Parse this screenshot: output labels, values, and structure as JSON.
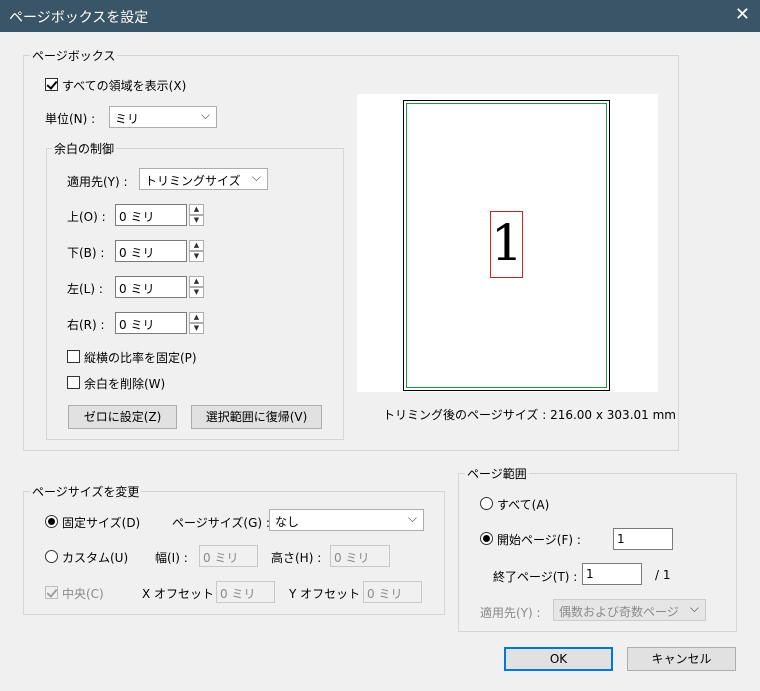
{
  "window": {
    "title": "ページボックスを設定",
    "close_glyph": "✕"
  },
  "pagebox": {
    "legend": "ページボックス",
    "show_all_label": "すべての領域を表示(X)",
    "show_all_checked": true,
    "unit_label": "単位(N) :",
    "unit_value": "ミリ",
    "margin_group": {
      "legend": "余白の制御",
      "apply_label": "適用先(Y) :",
      "apply_value": "トリミングサイズ",
      "top_label": "上(O) :",
      "top_value": "0 ミリ",
      "bottom_label": "下(B) :",
      "bottom_value": "0 ミリ",
      "left_label": "左(L) :",
      "left_value": "0 ミリ",
      "right_label": "右(R) :",
      "right_value": "0 ミリ",
      "fix_ratio_label": "縦横の比率を固定(P)",
      "fix_ratio_checked": false,
      "remove_margin_label": "余白を削除(W)",
      "remove_margin_checked": false,
      "set_zero_button": "ゼロに設定(Z)",
      "revert_button": "選択範囲に復帰(V)"
    },
    "preview": {
      "page_number": "1",
      "caption": "トリミング後のページサイズ : 216.00 x 303.01 mm"
    }
  },
  "change_size": {
    "legend": "ページサイズを変更",
    "fixed_label": "固定サイズ(D)",
    "fixed_selected": true,
    "size_label": "ページサイズ(G) :",
    "size_value": "なし",
    "custom_label": "カスタム(U)",
    "custom_selected": false,
    "width_label": "幅(I) :",
    "width_value": "0 ミリ",
    "height_label": "高さ(H) :",
    "height_value": "0 ミリ",
    "center_label": "中央(C)",
    "center_checked": true,
    "x_offset_label": "X オフセット :",
    "x_offset_value": "0 ミリ",
    "y_offset_label": "Y オフセット :",
    "y_offset_value": "0 ミリ"
  },
  "page_range": {
    "legend": "ページ範囲",
    "all_label": "すべて(A)",
    "all_selected": false,
    "start_label": "開始ページ(F) :",
    "start_selected": true,
    "start_value": "1",
    "end_label": "終了ページ(T) :",
    "end_value": "1",
    "total": "/ 1",
    "apply_label": "適用先(Y) :",
    "apply_value": "偶数および奇数ページ"
  },
  "footer": {
    "ok": "OK",
    "cancel": "キャンセル"
  },
  "glyphs": {
    "chevron": "⌵",
    "up": "▲",
    "down": "▼"
  }
}
